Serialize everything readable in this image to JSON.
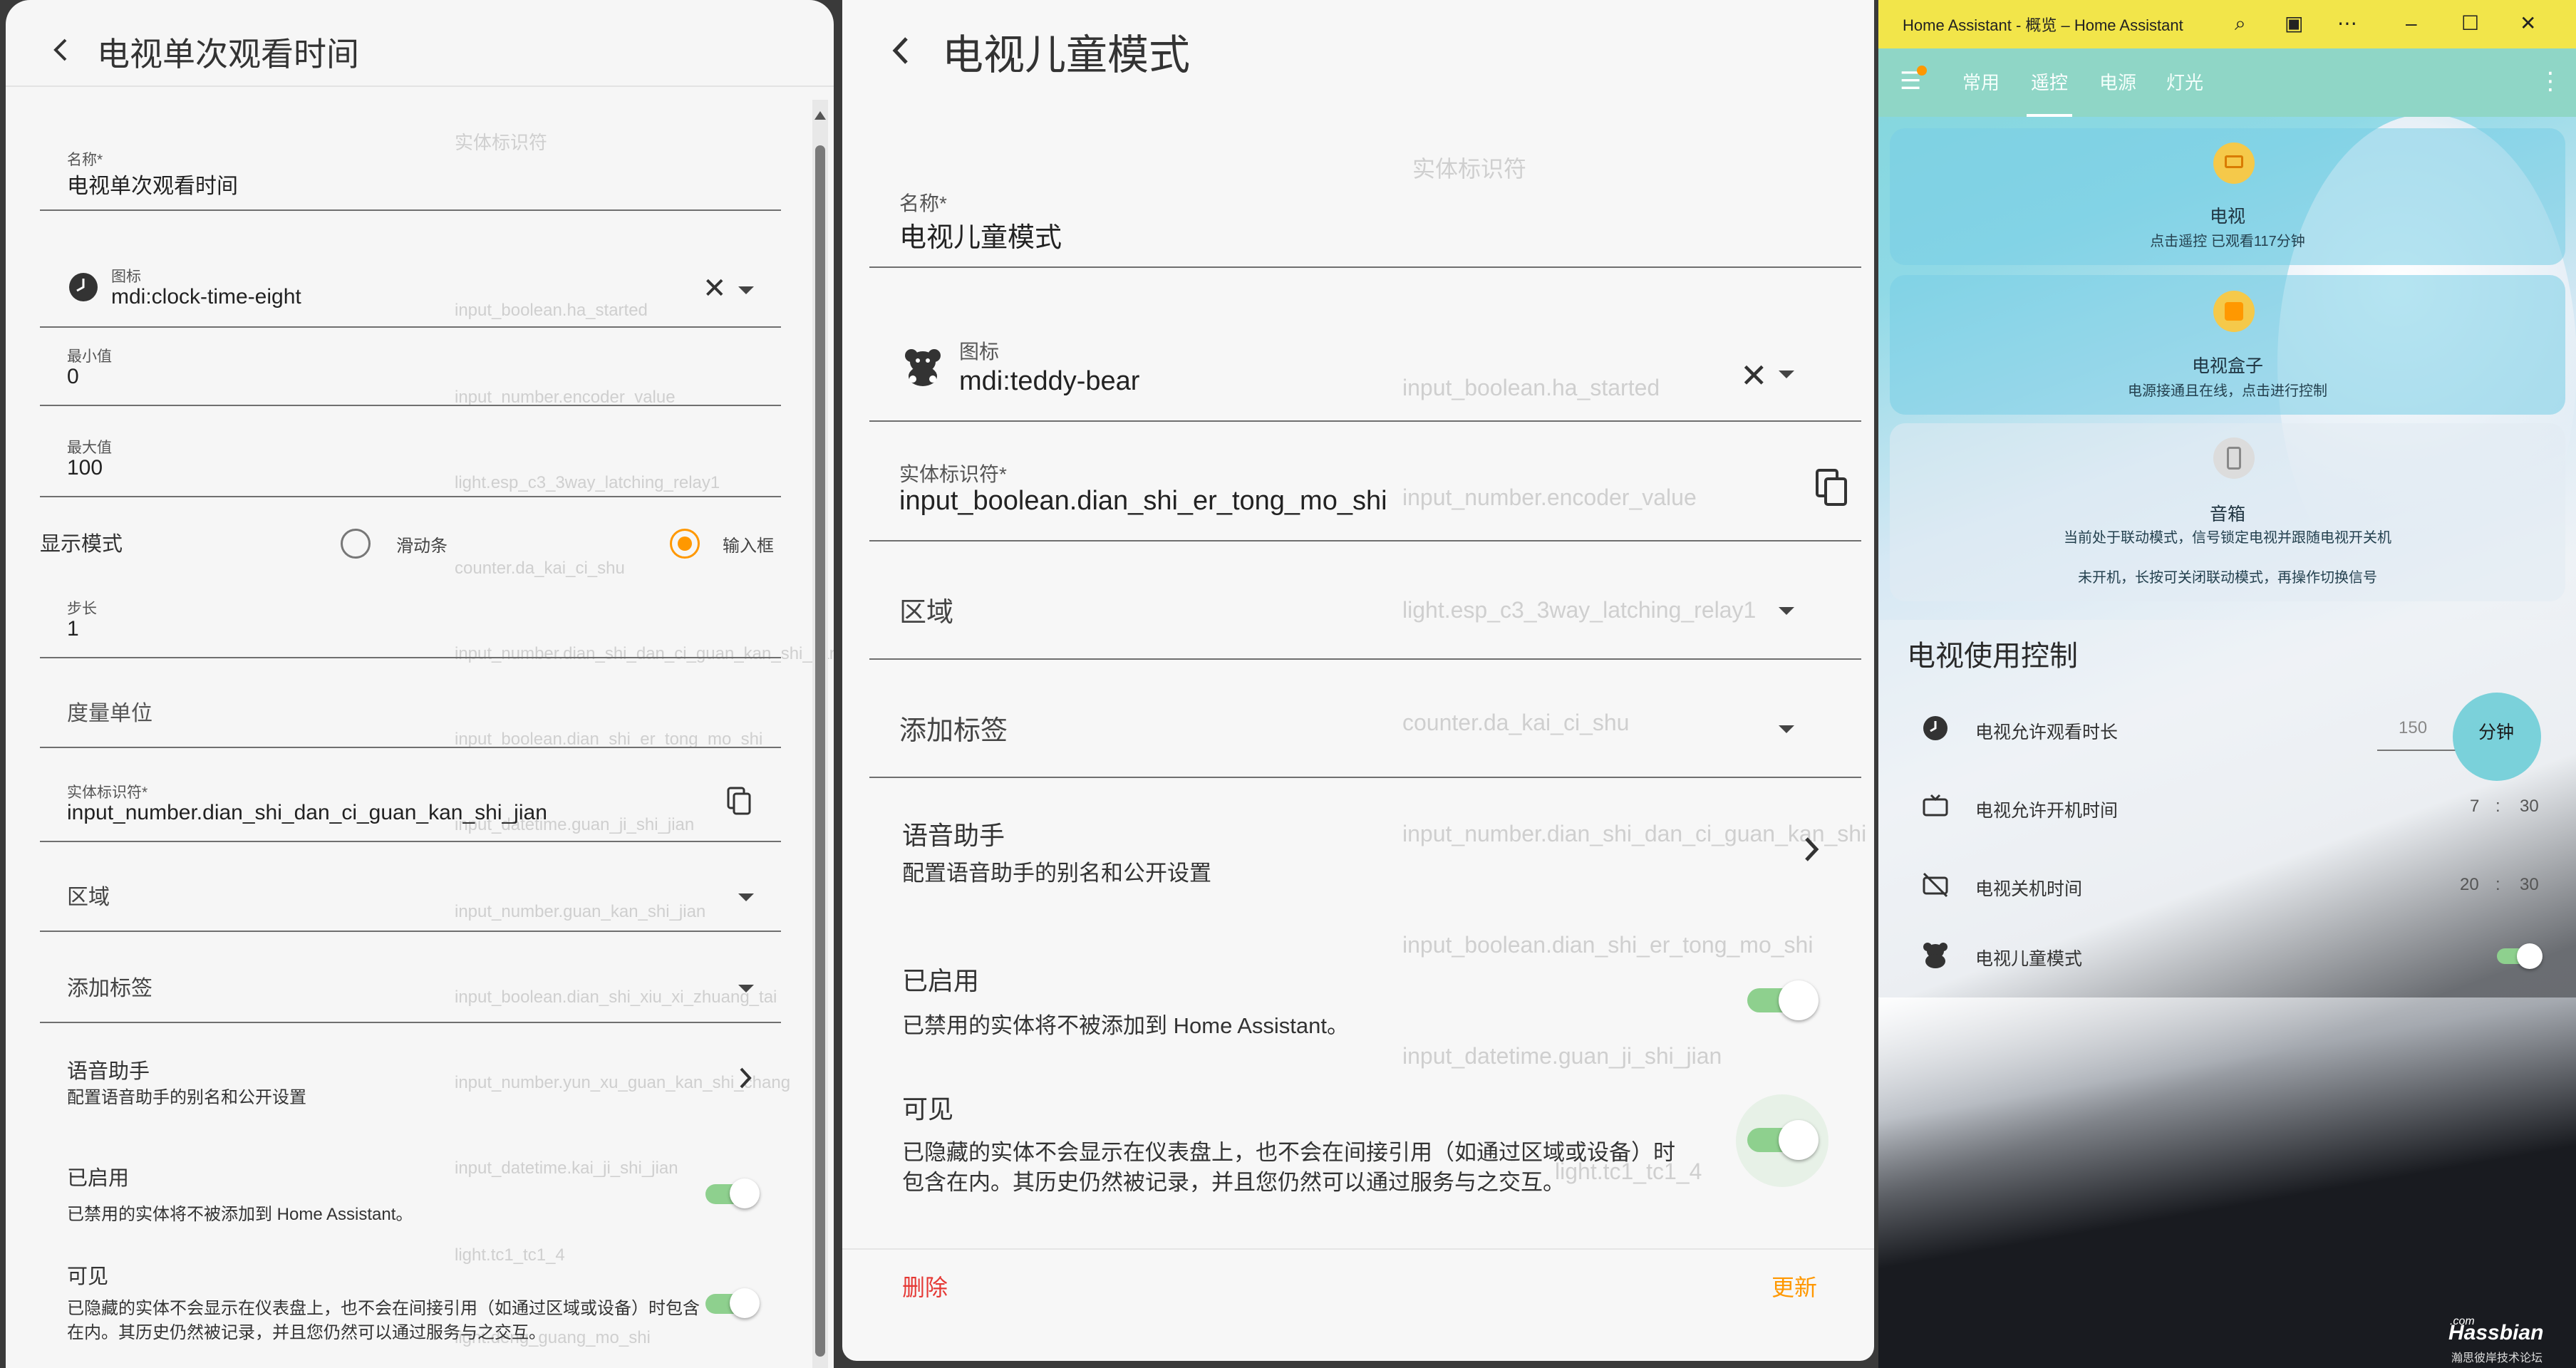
{
  "left_dialog": {
    "title": "电视单次观看时间",
    "name_label": "名称*",
    "name_value": "电视单次观看时间",
    "icon_label": "图标",
    "icon_value": "mdi:clock-time-eight",
    "min_label": "最小值",
    "min_value": "0",
    "max_label": "最大值",
    "max_value": "100",
    "display_mode_label": "显示模式",
    "display_mode_options": [
      "滑动条",
      "输入框"
    ],
    "display_mode_selected": "输入框",
    "step_label": "步长",
    "step_value": "1",
    "unit_label": "度量单位",
    "entity_id_label": "实体标识符*",
    "entity_id_value": "input_number.dian_shi_dan_ci_guan_kan_shi_jian",
    "area_label": "区域",
    "tags_label": "添加标签",
    "voice_title": "语音助手",
    "voice_sub": "配置语音助手的别名和公开设置",
    "enabled_title": "已启用",
    "enabled_sub": "已禁用的实体将不被添加到 Home Assistant。",
    "enabled_on": true,
    "visible_title": "可见",
    "visible_sub": "已隐藏的实体不会显示在仪表盘上，也不会在间接引用（如通过区域或设备）时包含在内。其历史仍然被记录，并且您仍然可以通过服务与之交互。",
    "visible_on": true,
    "ghost_texts": [
      "实体标识符",
      "input_boolean.ha_started",
      "input_number.encoder_value",
      "light.esp_c3_3way_latching_relay1",
      "counter.da_kai_ci_shu",
      "input_number.dian_shi_dan_ci_guan_kan_shi_jian",
      "input_boolean.dian_shi_er_tong_mo_shi",
      "input_datetime.guan_ji_shi_jian",
      "input_number.guan_kan_shi_jian",
      "input_boolean.dian_shi_xiu_xi_zhuang_tai",
      "input_number.yun_xu_guan_kan_shi_chang",
      "input_datetime.kai_ji_shi_jian",
      "light.tc1_tc1_4",
      "light.deng_guang_mo_shi"
    ]
  },
  "mid_dialog": {
    "title": "电视儿童模式",
    "name_label": "名称*",
    "name_value": "电视儿童模式",
    "icon_label": "图标",
    "icon_value": "mdi:teddy-bear",
    "entity_id_label": "实体标识符*",
    "entity_id_value": "input_boolean.dian_shi_er_tong_mo_shi",
    "area_label": "区域",
    "tags_label": "添加标签",
    "voice_title": "语音助手",
    "voice_sub": "配置语音助手的别名和公开设置",
    "enabled_title": "已启用",
    "enabled_sub": "已禁用的实体将不被添加到 Home Assistant。",
    "enabled_on": true,
    "visible_title": "可见",
    "visible_sub_1": "已隐藏的实体不会显示在仪表盘上，也不会在间接引用（如通过区域或设备）时",
    "visible_sub_2": "包含在内。其历史仍然被记录，并且您仍然可以通过服务与之交互。",
    "visible_on": true,
    "delete_label": "删除",
    "update_label": "更新",
    "ghost_texts": [
      "实体标识符",
      "input_boolean.ha_started",
      "input_number.encoder_value",
      "light.esp_c3_3way_latching_relay1",
      "counter.da_kai_ci_shu",
      "input_number.dian_shi_dan_ci_guan_kan_shi",
      "input_boolean.dian_shi_er_tong_mo_shi",
      "input_datetime.guan_ji_shi_jian",
      "light.tc1_tc1_4"
    ]
  },
  "ha_window": {
    "title": "Home Assistant - 概览 – Home Assistant",
    "tabs": [
      "常用",
      "遥控",
      "电源",
      "灯光"
    ],
    "active_tab": "遥控",
    "cards": [
      {
        "name": "电视",
        "state": "点击遥控 已观看117分钟"
      },
      {
        "name": "电视盒子",
        "state": "电源接通且在线，点击进行控制"
      },
      {
        "name": "音箱",
        "state": "当前处于联动模式，信号锁定电视并跟随电视开关机",
        "state2": "未开机，长按可关闭联动模式，再操作切换信号"
      }
    ],
    "control_title": "电视使用控制",
    "rows": [
      {
        "label": "电视允许观看时长",
        "value": "150",
        "unit": "分钟"
      },
      {
        "label": "电视允许开机时间",
        "hour": "7",
        "sep": ":",
        "minute": "30"
      },
      {
        "label": "电视关机时间",
        "hour": "20",
        "sep": ":",
        "minute": "30"
      },
      {
        "label": "电视儿童模式",
        "toggle_on": true
      }
    ],
    "watermark": "Hassbian",
    "watermark_com": ".com",
    "watermark_sub": "瀚思彼岸技术论坛",
    "colors": {
      "titlebar": "#f2e54a",
      "header": "#8fd6c6",
      "accent": "#ff9800"
    }
  }
}
